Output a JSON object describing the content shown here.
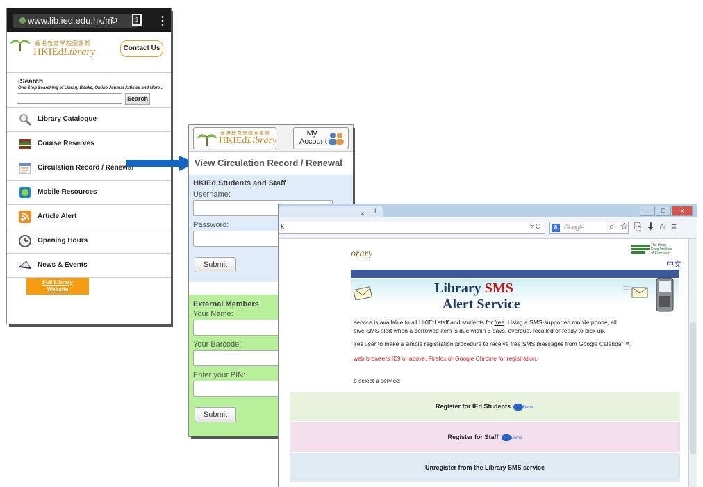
{
  "phone": {
    "url": "www.lib.ied.edu.hk/m",
    "logo_cn": "香港教育學院圖書館",
    "logo_en_prefix": "HKIEd",
    "logo_en_suffix": "Library",
    "contact_label": "Contact Us",
    "isearch_title": "iSearch",
    "isearch_subtitle": "One-Stop Searching of Library Books, Online Journal Articles and More...",
    "search_button": "Search",
    "menu": [
      {
        "label": "Library Catalogue",
        "icon": "magnifier-icon"
      },
      {
        "label": "Course Reserves",
        "icon": "books-icon"
      },
      {
        "label": "Circulation Record / Renewal",
        "icon": "calendar-icon"
      },
      {
        "label": "Mobile Resources",
        "icon": "mobile-globe-icon"
      },
      {
        "label": "Article Alert",
        "icon": "rss-icon"
      },
      {
        "label": "Opening Hours",
        "icon": "clock-icon"
      },
      {
        "label": "News & Events",
        "icon": "megaphone-icon"
      }
    ],
    "full_site_label_1": "Full Library",
    "full_site_label_2": "Website"
  },
  "login": {
    "logo_cn": "香港教育學院圖書館",
    "logo_en_prefix": "HKIEd",
    "logo_en_suffix": "Library",
    "account_label_1": "My",
    "account_label_2": "Account",
    "title": "View Circulation Record / Renewal",
    "staff": {
      "title": "HKIEd Students and Staff",
      "username_label": "Username:",
      "password_label": "Password:",
      "submit": "Submit"
    },
    "external": {
      "title": "External Members",
      "name_label": "Your Name:",
      "barcode_label": "Your Barcode:",
      "pin_label": "Enter your PIN:",
      "submit": "Submit"
    }
  },
  "desktop": {
    "tab_close": "×",
    "new_tab": "+",
    "window_min": "–",
    "window_max": "□",
    "window_close": "x",
    "address_text": "k",
    "search_placeholder": "Google",
    "brand_text": "orary",
    "ied_logo_text": "The Hong Kong Institute of Education",
    "lang_link": "中文",
    "banner_line1_a": "Library ",
    "banner_line1_b": "SMS",
    "banner_line2": "Alert Service",
    "para1_a": "service is available to all HKIEd staff and students for ",
    "para1_free": "free",
    "para1_b": ". Using a SMS-supported mobile phone, all",
    "para2": "eive SMS alert when a borrowed item is due within 3 days, overdue, recalled or ready to pick up.",
    "para3_a": "ires user to make a simple registration procedure to receive ",
    "para3_free": "free",
    "para3_b": " SMS messages from Google Calendar™.",
    "para4": "web browsers IE9 or above, Firefox or Google Chrome for registration.",
    "para5": "o select a service:",
    "rows": [
      {
        "label": "Register for IEd Students",
        "demo": "Demo",
        "bg": "#e9f2dd"
      },
      {
        "label": "Register for Staff",
        "demo": "Demo",
        "bg": "#f3e0ec"
      },
      {
        "label": "Unregister from the Library SMS service",
        "demo": "",
        "bg": "#dfeaf2"
      }
    ]
  },
  "colors": {
    "arrow": "#1466c2",
    "orange": "#f39c12",
    "login_blue": "#deedf9",
    "login_green": "#b9f09b"
  }
}
